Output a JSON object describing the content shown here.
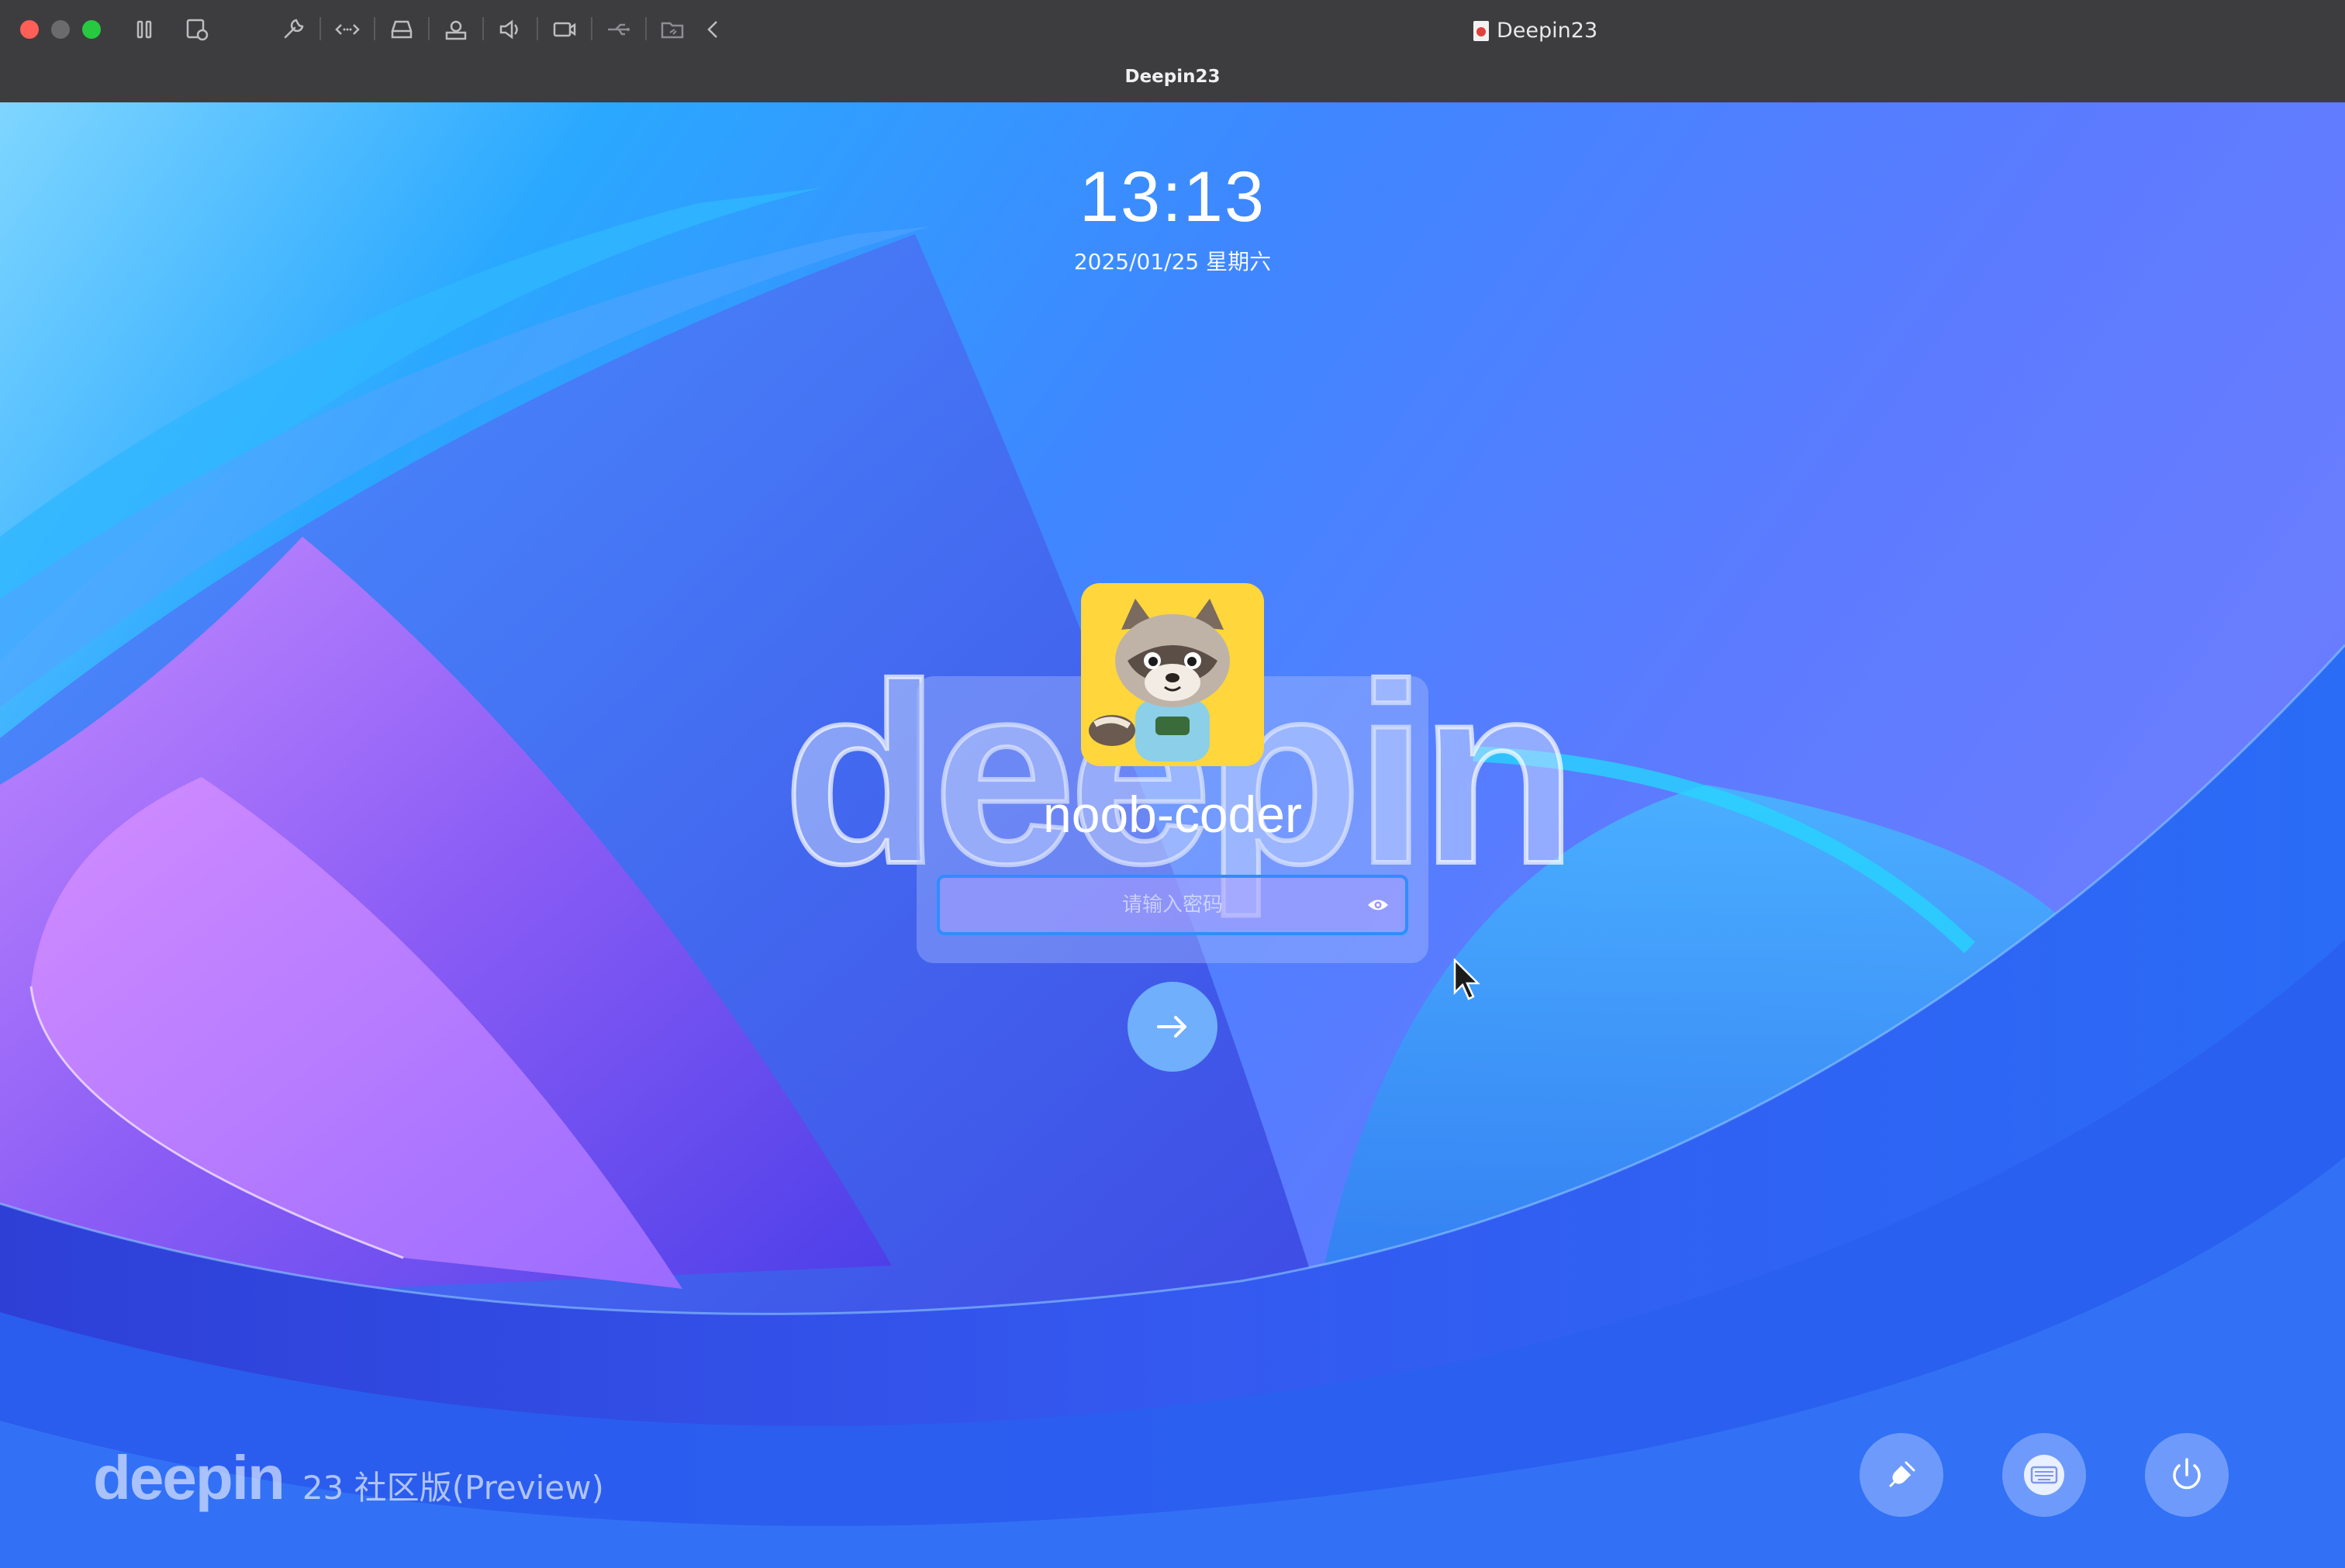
{
  "window": {
    "title": "Deepin23",
    "tab_label": "Deepin23"
  },
  "toolbar": {
    "icons": [
      "pause-icon",
      "snapshot-icon",
      "wrench-icon",
      "code-icon",
      "drive-icon",
      "printer-icon",
      "volume-icon",
      "camera-icon",
      "usb-icon",
      "shared-folder-icon",
      "back-icon"
    ]
  },
  "lockscreen": {
    "time": "13:13",
    "date": "2025/01/25 星期六",
    "username": "noob-coder",
    "password_placeholder": "请输入密码",
    "brand": "deepin",
    "edition": "23 社区版(Preview)"
  },
  "colors": {
    "accent": "#2f8dff",
    "close": "#ff5f57",
    "zoom": "#28c840"
  }
}
